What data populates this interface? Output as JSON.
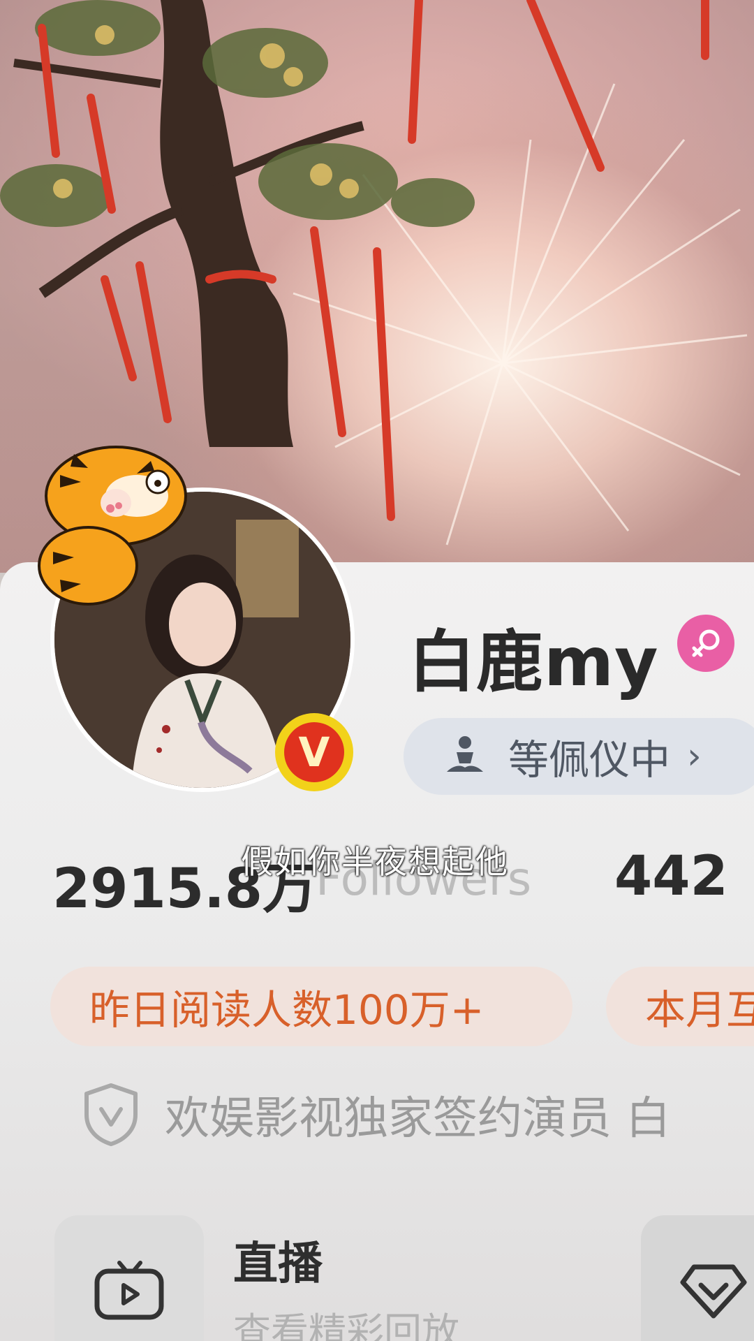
{
  "profile": {
    "name": "白鹿my",
    "gender_icon": "female-icon",
    "status_label": "等佩仪中",
    "status_chevron": "›",
    "verified_badge": "V"
  },
  "stats": {
    "followers_count": "2915.8万",
    "followers_label": "Followers",
    "second_count": "442"
  },
  "subtitle": "假如你半夜想起他",
  "tags": [
    {
      "label": "昨日阅读人数100万+"
    },
    {
      "label": "本月互"
    }
  ],
  "verification": {
    "icon": "shield-v-icon",
    "text": "欢娱影视独家签约演员 白"
  },
  "services": [
    {
      "title": "直播",
      "subtitle": "查看精彩回放",
      "icon": "tv-play-icon"
    },
    {
      "icon": "diamond-icon"
    }
  ],
  "colors": {
    "tag_bg": "#f1e2dc",
    "tag_text": "#d8602a",
    "status_bg": "#dfe3ea",
    "gender_bg": "#e95fa5",
    "badge_yellow": "#f2d21a",
    "badge_red": "#e0321e"
  }
}
